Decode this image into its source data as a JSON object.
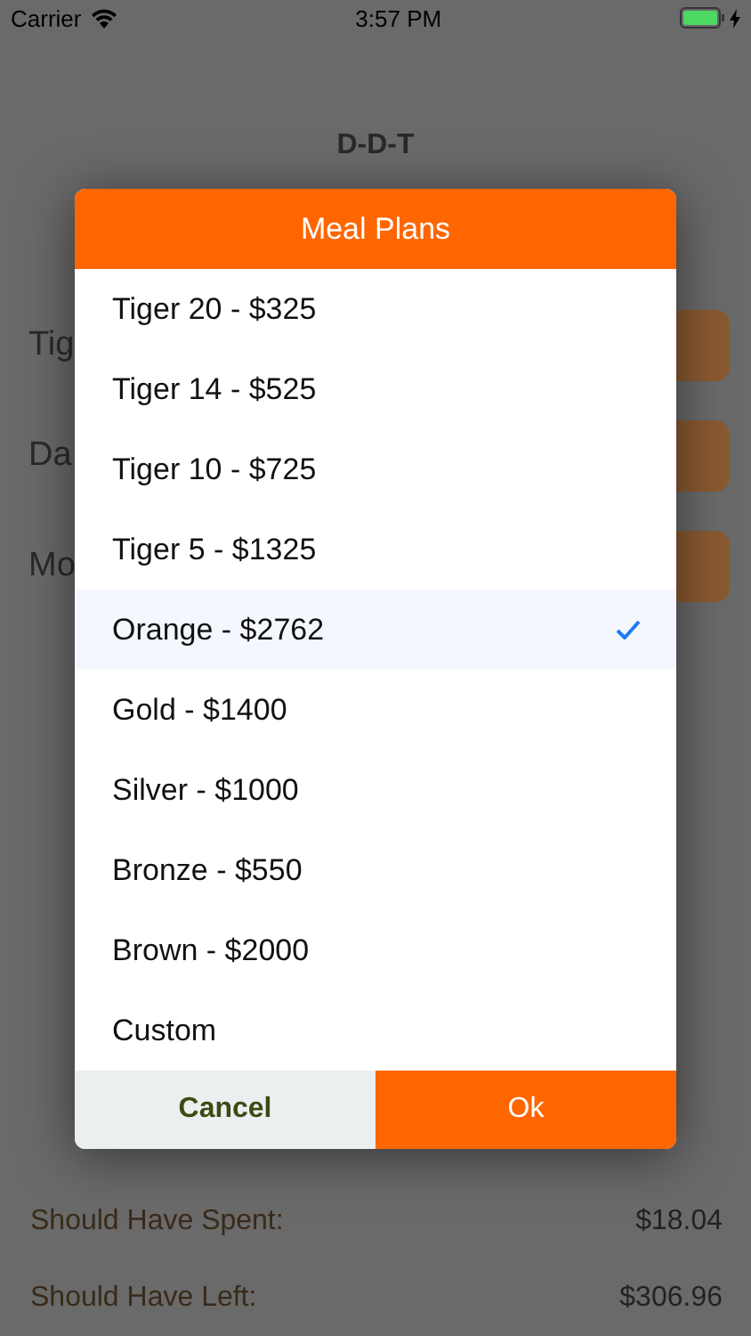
{
  "status_bar": {
    "carrier": "Carrier",
    "time": "3:57 PM",
    "charging": true
  },
  "page": {
    "title": "D-D-T",
    "fields": [
      {
        "label": "Tig"
      },
      {
        "label": "Da"
      },
      {
        "label": "Mo"
      }
    ],
    "summary": [
      {
        "label": "Should Have Spent:",
        "value": "$18.04"
      },
      {
        "label": "Should Have Left:",
        "value": "$306.96"
      }
    ]
  },
  "dialog": {
    "title": "Meal Plans",
    "options": [
      {
        "label": "Tiger 20 - $325",
        "selected": false
      },
      {
        "label": "Tiger 14 - $525",
        "selected": false
      },
      {
        "label": "Tiger 10 - $725",
        "selected": false
      },
      {
        "label": "Tiger 5 - $1325",
        "selected": false
      },
      {
        "label": "Orange - $2762",
        "selected": true
      },
      {
        "label": "Gold - $1400",
        "selected": false
      },
      {
        "label": "Silver - $1000",
        "selected": false
      },
      {
        "label": "Bronze - $550",
        "selected": false
      },
      {
        "label": "Brown - $2000",
        "selected": false
      },
      {
        "label": "Custom",
        "selected": false
      }
    ],
    "buttons": [
      {
        "label": "Cancel",
        "kind": "secondary"
      },
      {
        "label": "Ok",
        "kind": "primary"
      }
    ]
  }
}
